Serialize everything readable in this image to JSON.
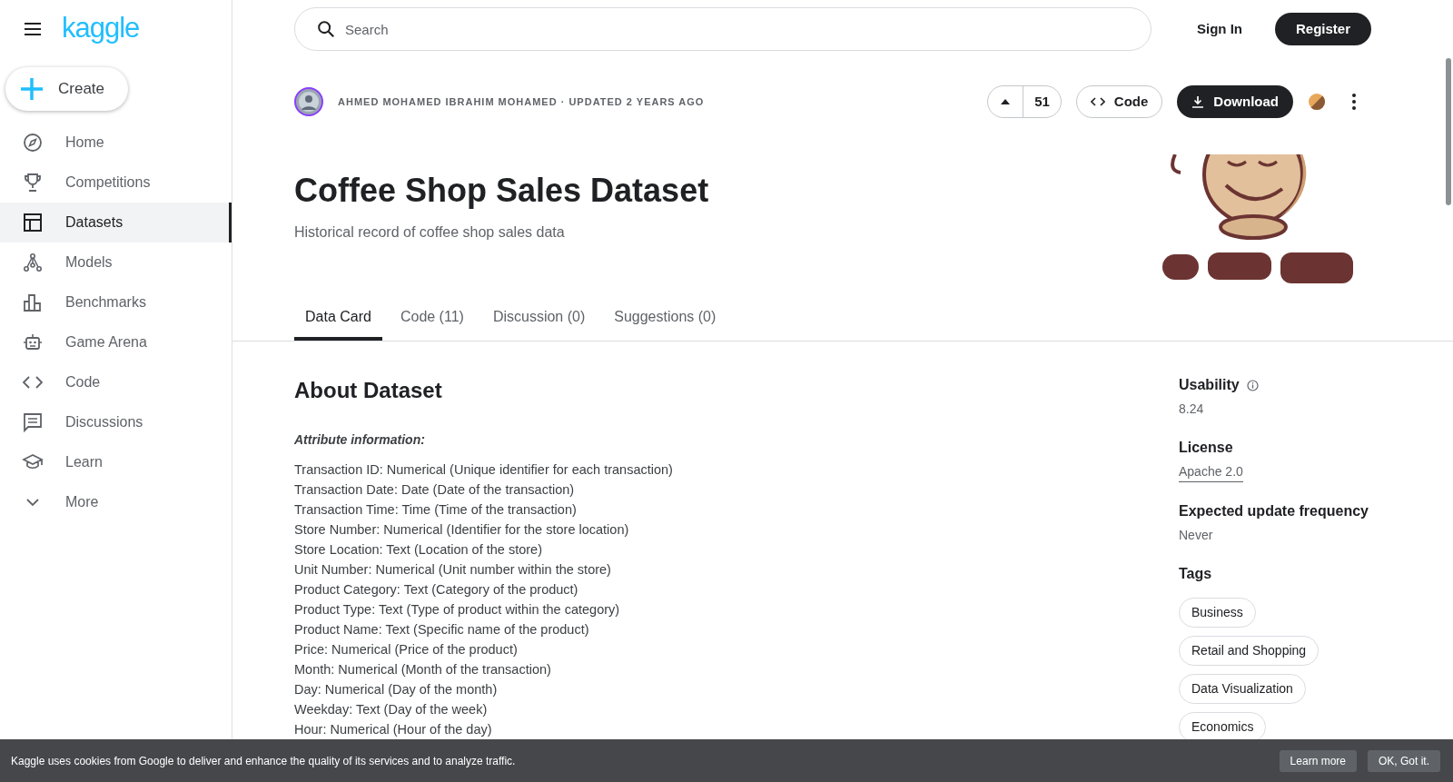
{
  "logo": "kaggle",
  "create_button": "Create",
  "sidebar": {
    "items": [
      {
        "label": "Home",
        "selected": false
      },
      {
        "label": "Competitions",
        "selected": false
      },
      {
        "label": "Datasets",
        "selected": true
      },
      {
        "label": "Models",
        "selected": false
      },
      {
        "label": "Benchmarks",
        "selected": false
      },
      {
        "label": "Game Arena",
        "selected": false
      },
      {
        "label": "Code",
        "selected": false
      },
      {
        "label": "Discussions",
        "selected": false
      },
      {
        "label": "Learn",
        "selected": false
      },
      {
        "label": "More",
        "selected": false
      }
    ]
  },
  "search": {
    "placeholder": "Search"
  },
  "header_buttons": [
    "Sign In",
    "Register"
  ],
  "byline": "AHMED MOHAMED IBRAHIM MOHAMED · UPDATED 2 YEARS AGO",
  "vote_count": "51",
  "code_button": "Code",
  "download_button": "Download",
  "title": "Coffee Shop Sales Dataset",
  "subtitle": "Historical record of coffee shop sales data",
  "tabs": [
    {
      "label": "Data Card",
      "selected": true
    },
    {
      "label": "Code (11)",
      "selected": false
    },
    {
      "label": "Discussion (0)",
      "selected": false
    },
    {
      "label": "Suggestions (0)",
      "selected": false
    }
  ],
  "about": {
    "heading": "About Dataset",
    "subheading": "Attribute information:",
    "lines": [
      "Transaction ID: Numerical (Unique identifier for each transaction)",
      "Transaction Date: Date (Date of the transaction)",
      "Transaction Time: Time (Time of the transaction)",
      "Store Number: Numerical (Identifier for the store location)",
      "Store Location: Text (Location of the store)",
      "Unit Number: Numerical (Unit number within the store)",
      "Product Category: Text (Category of the product)",
      "Product Type: Text (Type of product within the category)",
      "Product Name: Text (Specific name of the product)",
      "Price: Numerical (Price of the product)",
      "Month: Numerical (Month of the transaction)",
      "Day: Numerical (Day of the month)",
      "Weekday: Text (Day of the week)",
      "Hour: Numerical (Hour of the day)"
    ]
  },
  "details": {
    "usability_label": "Usability",
    "usability": "8.24",
    "license_label": "License",
    "license": "Apache 2.0",
    "frequency_label": "Expected update frequency",
    "frequency": "Never",
    "tags_label": "Tags",
    "tags": [
      "Business",
      "Retail and Shopping",
      "Data Visualization",
      "Economics"
    ]
  },
  "cookie_bar": {
    "message": "Kaggle uses cookies from Google to deliver and enhance the quality of its services and to analyze traffic.",
    "buttons": [
      "Learn more",
      "OK, Got it."
    ]
  }
}
